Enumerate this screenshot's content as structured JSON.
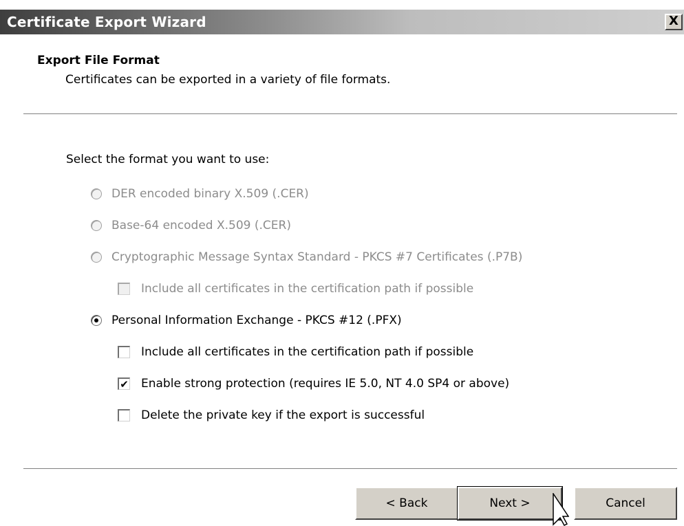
{
  "window": {
    "title": "Certificate Export Wizard",
    "close_label": "X"
  },
  "header": {
    "title": "Export File Format",
    "subtitle": "Certificates can be exported in a variety of file formats."
  },
  "prompt": "Select the format you want to use:",
  "options": [
    {
      "type": "radio",
      "label": "DER encoded binary X.509 (.CER)",
      "selected": false,
      "enabled": false
    },
    {
      "type": "radio",
      "label": "Base-64 encoded X.509 (.CER)",
      "selected": false,
      "enabled": false
    },
    {
      "type": "radio",
      "label": "Cryptographic Message Syntax Standard - PKCS #7 Certificates (.P7B)",
      "selected": false,
      "enabled": false
    },
    {
      "type": "checkbox",
      "label": "Include all certificates in the certification path if possible",
      "checked": false,
      "enabled": false
    },
    {
      "type": "radio",
      "label": "Personal Information Exchange - PKCS #12 (.PFX)",
      "selected": true,
      "enabled": true
    },
    {
      "type": "checkbox",
      "label": "Include all certificates in the certification path if possible",
      "checked": false,
      "enabled": true
    },
    {
      "type": "checkbox",
      "label": "Enable strong protection (requires IE 5.0, NT 4.0 SP4 or above)",
      "checked": true,
      "enabled": true
    },
    {
      "type": "checkbox",
      "label": "Delete the private key if the export is successful",
      "checked": false,
      "enabled": true
    }
  ],
  "buttons": {
    "back": "< Back",
    "next": "Next >",
    "cancel": "Cancel"
  },
  "colors": {
    "dialog_bg": "#ffffff",
    "button_face": "#d4d0c8",
    "disabled_text": "#8c8c8c"
  }
}
